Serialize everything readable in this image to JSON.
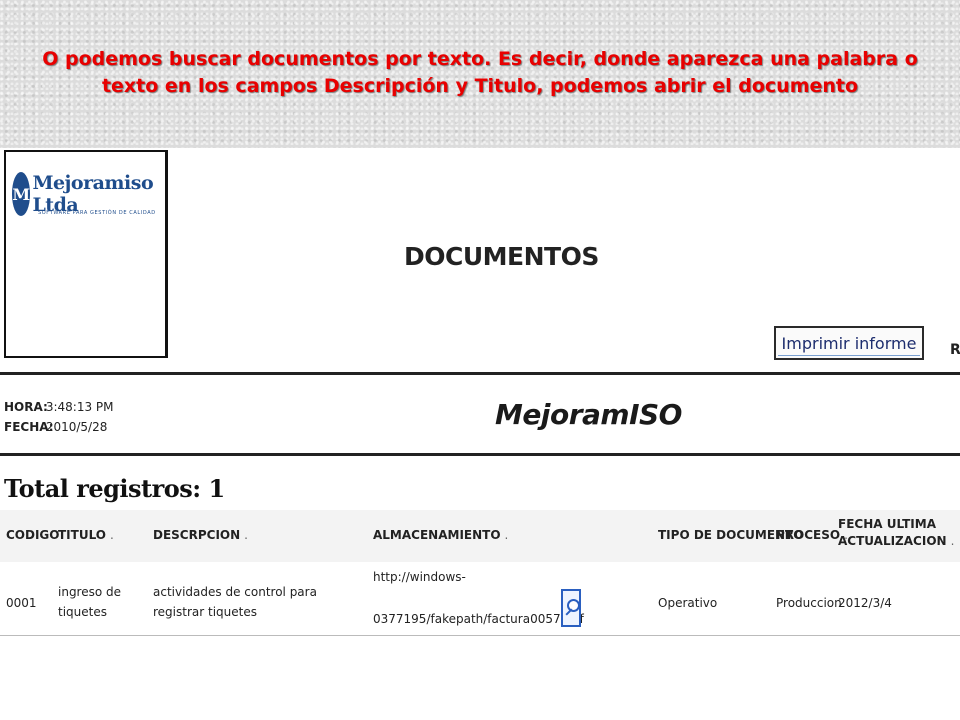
{
  "caption": "O podemos buscar documentos por texto. Es decir, donde aparezca una palabra o texto en los campos Descripción y Titulo, podemos abrir el documento",
  "logo": {
    "mark": "M",
    "name": "Mejoramiso Ltda",
    "tagline": "SOFTWARE PARA GESTIÓN DE CALIDAD"
  },
  "page_title": "DOCUMENTOS",
  "print_button_label": "Imprimir informe",
  "edge_text": "R",
  "report_header": {
    "hora_label": "HORA:",
    "hora_value": "3:48:13 PM",
    "fecha_label": "FECHA:",
    "fecha_value": "2010/5/28",
    "brand": "MejoramISO"
  },
  "total_registros": "Total registros: 1",
  "table": {
    "columns": [
      {
        "label": "CODIGO",
        "sort": ""
      },
      {
        "label": "TITULO",
        "sort": "."
      },
      {
        "label": "DESCRPCION",
        "sort": "."
      },
      {
        "label": "ALMACENAMIENTO",
        "sort": "."
      },
      {
        "label": "TIPO DE DOCUMENTO",
        "sort": ""
      },
      {
        "label": "PROCESO",
        "sort": "."
      },
      {
        "label": "FECHA ULTIMA ACTUALIZACION",
        "sort": "."
      }
    ],
    "rows": [
      {
        "codigo": "0001",
        "titulo": "ingreso de tiquetes",
        "descripcion": "actividades de control para registrar tiquetes",
        "almacenamiento_line1": "http://windows-",
        "almacenamiento_line2": "0377195/fakepath/factura0057.pdf",
        "tipo": "Operativo",
        "proceso": "Produccion",
        "fecha": "2012/3/4"
      }
    ]
  },
  "icons": {
    "view_document": "magnifier-icon"
  },
  "colors": {
    "caption": "#e80000",
    "logo": "#1f4d8c",
    "button_text": "#1d2d6e"
  }
}
